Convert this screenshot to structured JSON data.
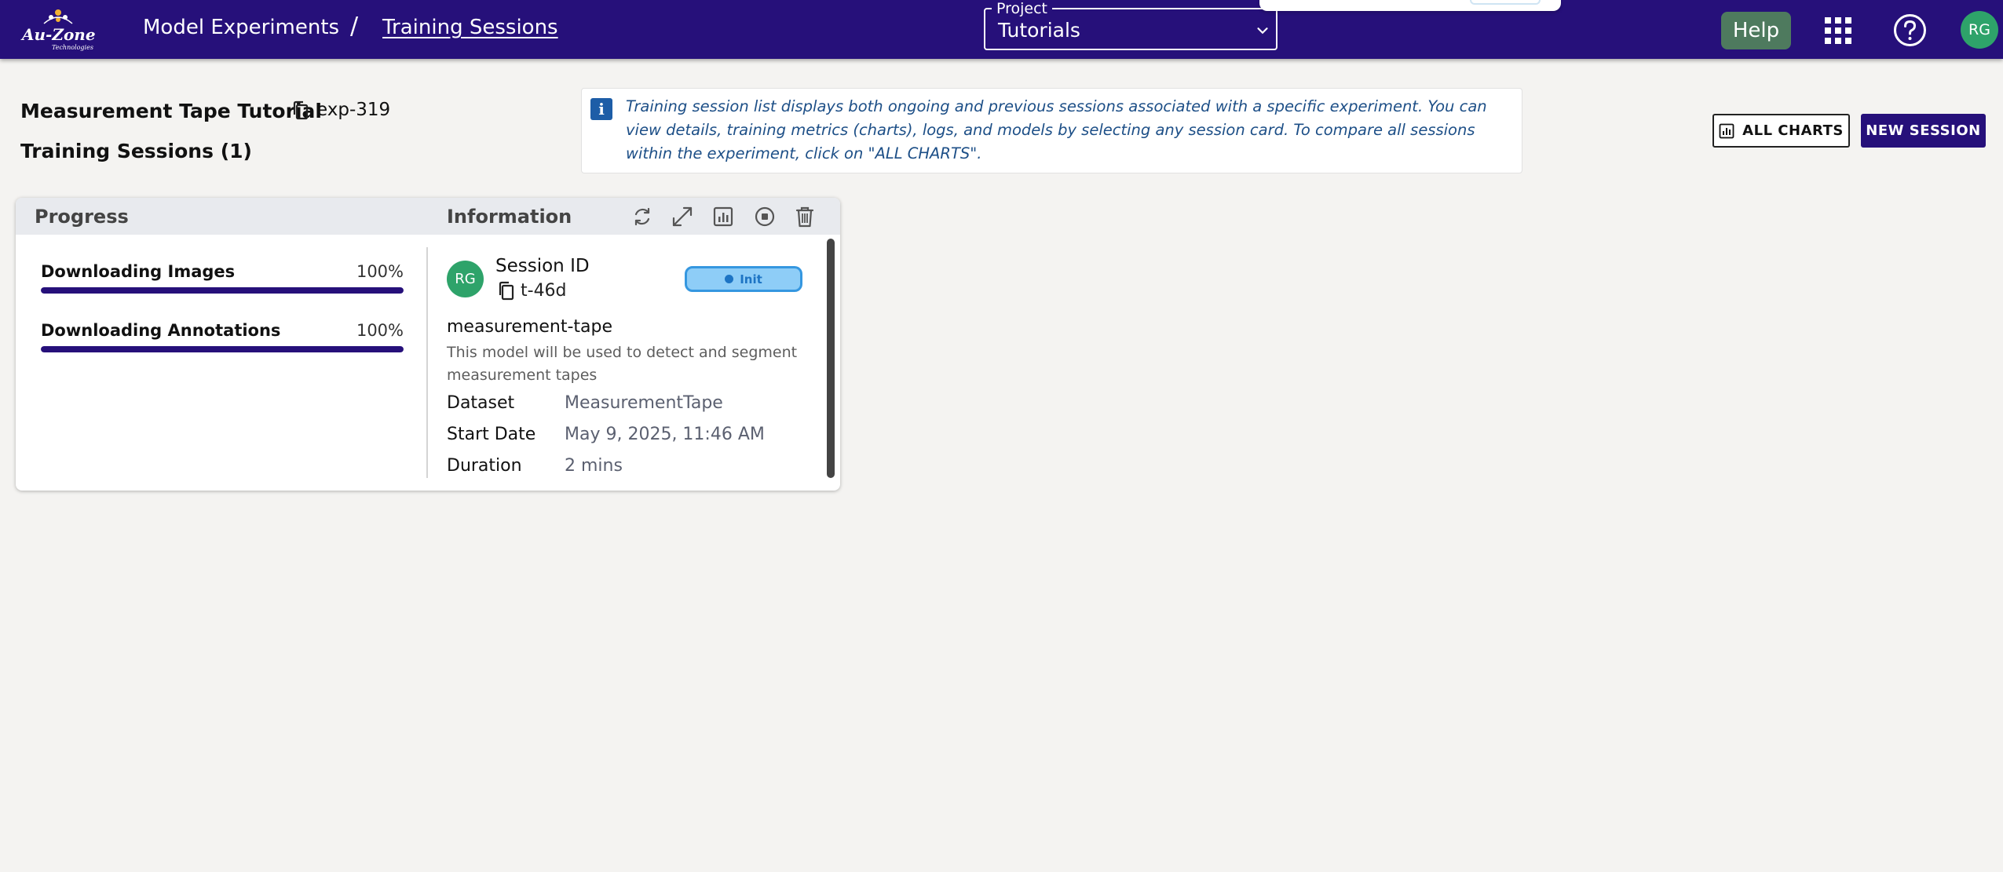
{
  "header": {
    "logo_text": "Au-Zone",
    "logo_sub": "Technologies",
    "breadcrumb": {
      "parent": "Model Experiments",
      "separator": "/",
      "current": "Training Sessions"
    },
    "project": {
      "legend": "Project",
      "value": "Tutorials"
    },
    "help_label": "Help",
    "user_initials": "RG"
  },
  "experiment": {
    "title": "Measurement Tape Tutorial",
    "id": "exp-319",
    "sessions_heading": "Training Sessions (1)"
  },
  "info_banner": {
    "icon": "i",
    "text": "Training session list displays both ongoing and previous sessions associated with a specific experiment. You can view details, training metrics (charts), logs, and models by selecting any session card. To compare all sessions within the experiment, click on \"ALL CHARTS\"."
  },
  "actions": {
    "all_charts": "ALL CHARTS",
    "new_session": "NEW SESSION"
  },
  "session_card": {
    "progress_header": "Progress",
    "info_header": "Information",
    "header_icons": [
      "refresh-icon",
      "expand-icon",
      "chart-icon",
      "stop-icon",
      "delete-icon"
    ],
    "progress": [
      {
        "label": "Downloading Images",
        "percent_label": "100%",
        "value": 100
      },
      {
        "label": "Downloading Annotations",
        "percent_label": "100%",
        "value": 100
      }
    ],
    "user_initials": "RG",
    "session_id_label": "Session ID",
    "session_id": "t-46d",
    "status": "Init",
    "model_name": "measurement-tape",
    "model_description": "This model will be used to detect and segment measurement tapes",
    "details": [
      {
        "label": "Dataset",
        "value": "MeasurementTape"
      },
      {
        "label": "Start Date",
        "value": "May 9, 2025, 11:46 AM"
      },
      {
        "label": "Duration",
        "value": "2 mins"
      }
    ]
  },
  "colors": {
    "brand": "#26107a",
    "help_button": "#4e7a5e",
    "avatar": "#2ea36a",
    "status_badge_bg": "#8ecdf7",
    "status_badge_border": "#3597e0",
    "info_text": "#1d4f87"
  }
}
